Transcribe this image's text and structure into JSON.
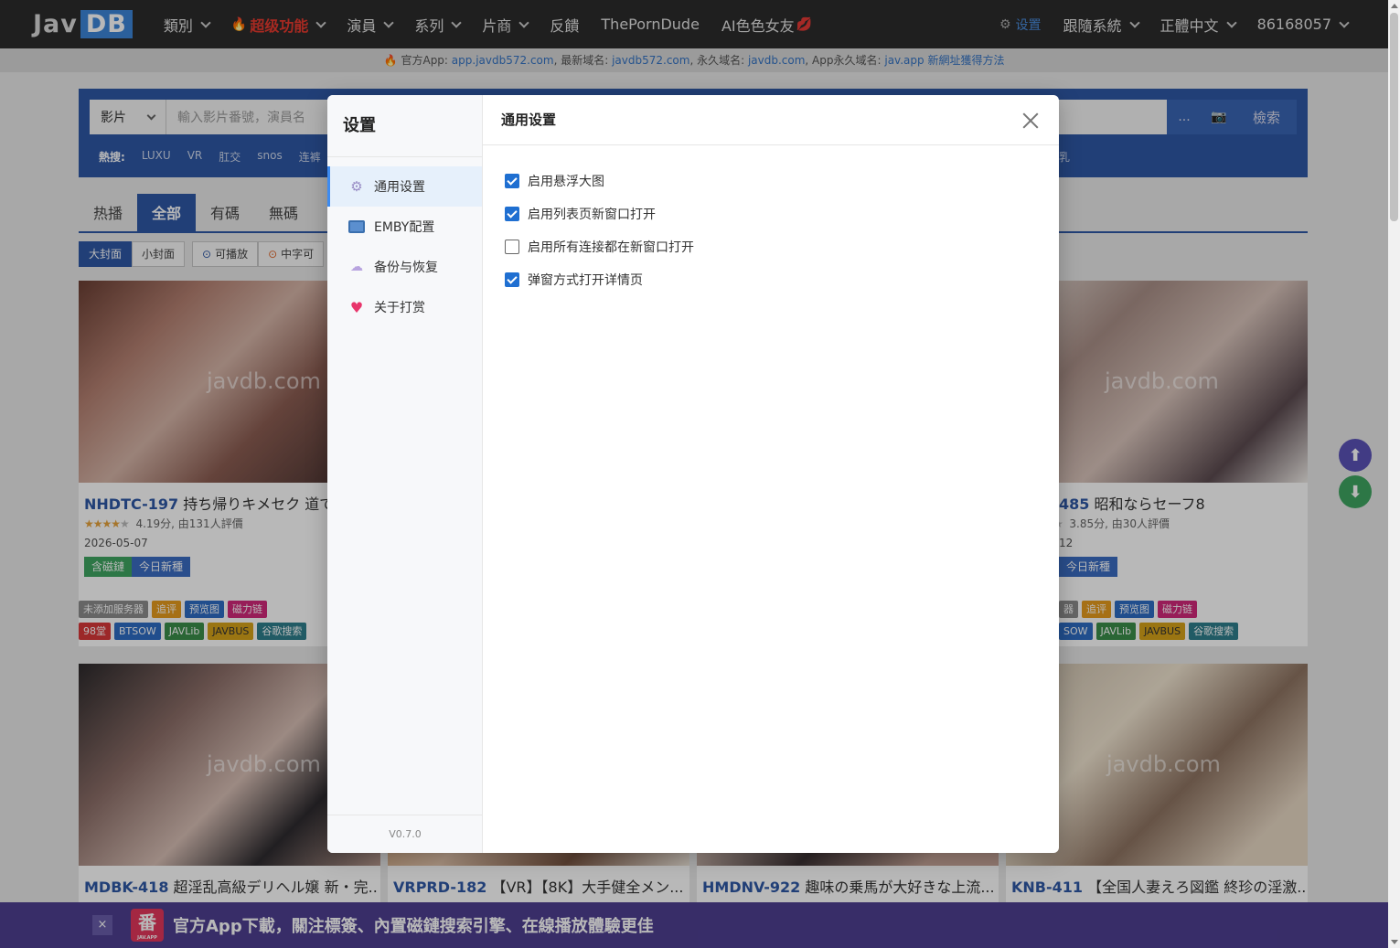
{
  "navbar": {
    "logo_left": "Jav",
    "logo_right": "DB",
    "items": [
      {
        "label": "類別",
        "has_dropdown": true
      },
      {
        "label": "超级功能",
        "has_dropdown": true
      },
      {
        "label": "演員",
        "has_dropdown": true
      },
      {
        "label": "系列",
        "has_dropdown": true
      },
      {
        "label": "片商",
        "has_dropdown": true
      },
      {
        "label": "反饋"
      },
      {
        "label": "ThePornDude"
      },
      {
        "label": "AI色色女友"
      }
    ],
    "right": {
      "settings": "设置",
      "follow": "跟隨系統",
      "language": "正體中文",
      "user": "86168057"
    }
  },
  "announce": {
    "l1": "官方App: ",
    "app_link": "app.javdb572.com",
    "l2": ", 最新域名: ",
    "new_domain": "javdb572.com",
    "l3": ", 永久域名: ",
    "perm_domain": "javdb.com",
    "l4": ", App永久域名: ",
    "app_domain": "jav.app",
    "method_link": "新網址獲得方法"
  },
  "search": {
    "type": "影片",
    "placeholder": "輸入影片番號，演員名",
    "more": "...",
    "submit": "檢索",
    "hot_label": "熱搜:",
    "hot_terms": [
      "LUXU",
      "VR",
      "肛交",
      "snos",
      "连裤"
    ],
    "hot_tail": "乳"
  },
  "tabs": [
    "热播",
    "全部",
    "有碼",
    "無碼"
  ],
  "filters": {
    "big_cover": "大封面",
    "small_cover": "小封面",
    "playable": "可播放",
    "chinese": "中字可"
  },
  "cards": [
    {
      "code": "NHDTC-197",
      "title": " 持ち帰りキメセク 道で",
      "watermark": "javdb.com",
      "score": "4.19分, 由131人評價",
      "stars_on": 4,
      "date": "2026-05-07",
      "tags": [
        "含磁鏈",
        "今日新種"
      ],
      "mini1": [
        "未添加服务器",
        "追评",
        "预览图",
        "磁力链"
      ],
      "mini2": [
        "98堂",
        "BTSOW",
        "JAVLib",
        "JAVBUS",
        "谷歌搜索"
      ]
    },
    {
      "code": "485",
      "title": " 昭和ならセーフ8",
      "watermark": "javdb.com",
      "score": "3.85分, 由30人評價",
      "stars_on": 4,
      "date": "12",
      "tags": [
        "今日新種"
      ],
      "mini1": [
        "器",
        "追评",
        "预览图",
        "磁力链"
      ],
      "mini2": [
        "SOW",
        "JAVLib",
        "JAVBUS",
        "谷歌搜索"
      ]
    },
    {
      "code": "MDBK-418",
      "title": " 超淫乱高級デリヘル嬢 新・完...",
      "watermark": "javdb.com"
    },
    {
      "code": "VRPRD-182",
      "title": " 【VR】【8K】大手健全メン...",
      "watermark": ""
    },
    {
      "code": "HMDNV-922",
      "title": " 趣味の乗馬が大好きな上流...",
      "watermark": ""
    },
    {
      "code": "KNB-411",
      "title": " 【全国人妻えろ図鑑 終珍の淫激...",
      "watermark": "javdb.com"
    }
  ],
  "banner": {
    "close": "×",
    "logo_char": "番",
    "logo_sub": "JAV.APP",
    "text": "官方App下載，關注標簽、內置磁鏈搜索引擎、在線播放體驗更佳"
  },
  "modal": {
    "sidebar_title": "设置",
    "menu": [
      {
        "label": "通用设置",
        "icon": "gear-icon",
        "active": true
      },
      {
        "label": "EMBY配置",
        "icon": "monitor-icon",
        "active": false
      },
      {
        "label": "备份与恢复",
        "icon": "cloud-icon",
        "active": false
      },
      {
        "label": "关于打赏",
        "icon": "heart-icon",
        "active": false
      }
    ],
    "version": "V0.7.0",
    "heading": "通用设置",
    "options": [
      {
        "label": "启用悬浮大图",
        "checked": true
      },
      {
        "label": "启用列表页新窗口打开",
        "checked": true
      },
      {
        "label": "启用所有连接都在新窗口打开",
        "checked": false
      },
      {
        "label": "弹窗方式打开详情页",
        "checked": true
      }
    ]
  },
  "colors": {
    "brand_blue": "#2e58a6",
    "navbar": "#2b2b2b",
    "checkbox_blue": "#1f6fd1",
    "banner_purple": "#4e3f91"
  }
}
